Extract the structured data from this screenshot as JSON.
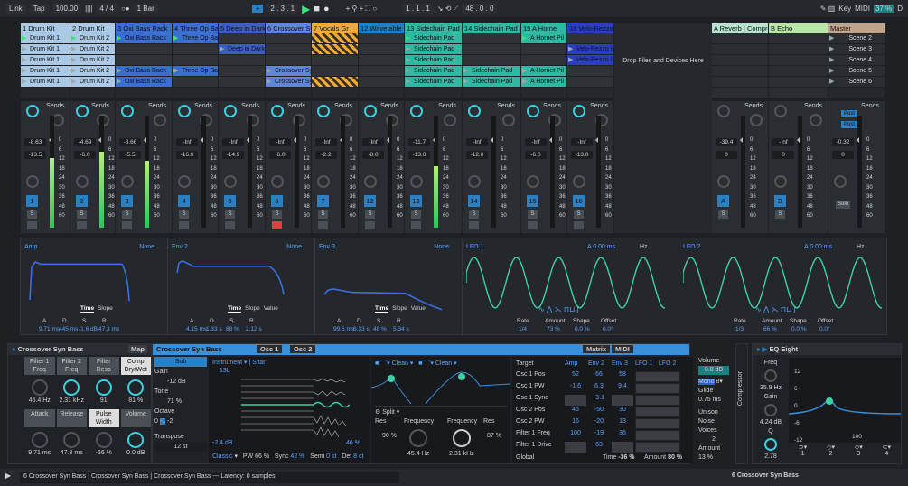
{
  "transport": {
    "link": "Link",
    "tap": "Tap",
    "tempo": "100.00",
    "signature": "4 / 4",
    "quantize": "1 Bar",
    "position": "2 .  3 .  1",
    "loop_start": "1 .  1 .  1",
    "loop_length": "48 .  0 .  0",
    "key": "Key",
    "midi": "MIDI",
    "cpu": "37 %",
    "d": "D"
  },
  "tracks": [
    {
      "name": "1 Drum Kit",
      "color": "#a9c9e6",
      "num": "1",
      "clips": [
        [
          "Drum Kit 1",
          "play"
        ],
        [
          "Drum Kit 1",
          "trig"
        ],
        [
          "Drum Kit 1",
          "trig"
        ],
        [
          "Drum Kit 1",
          "trig"
        ],
        [
          "Drum Kit 1",
          "trig"
        ]
      ],
      "vol": "-8.63",
      "val2": "-13.5",
      "meter": 0.62
    },
    {
      "name": "2 Drum Kit",
      "color": "#a9c9e6",
      "num": "2",
      "clips": [
        [
          "Drum Kit 2",
          "play"
        ],
        [
          "Drum Kit 2",
          "trig"
        ],
        [
          "Drum Kit 2",
          "trig"
        ],
        [
          "Drum Kit 2",
          "trig"
        ],
        [
          "Drum Kit 2",
          "trig"
        ]
      ],
      "vol": "-4.69",
      "val2": "-6.0",
      "meter": 0.68
    },
    {
      "name": "3 Oxi Bass Rack",
      "color": "#3a6fd1",
      "num": "3",
      "clips": [
        [
          "Oxi Bass Rack",
          "play"
        ],
        null,
        null,
        [
          "Oxi Bass Rack",
          "trig"
        ],
        [
          "Oxi Bass Rack",
          "trig"
        ]
      ],
      "vol": "-8.66",
      "val2": "-5.5",
      "meter": 0.6
    },
    {
      "name": "4 Three Op Ba",
      "color": "#3a6fd1",
      "num": "4",
      "clips": [
        [
          "Three Op Ba",
          "play"
        ],
        null,
        null,
        [
          "Three Op Ba",
          "trig"
        ],
        null
      ],
      "vol": "-Inf",
      "val2": "-16.0",
      "meter": 0
    },
    {
      "name": "5 Deep in Dark",
      "color": "#3d5dbf",
      "num": "5",
      "clips": [
        null,
        [
          "Deep in Dark",
          "trig"
        ],
        null,
        null,
        null
      ],
      "vol": "-Inf",
      "val2": "-14.9",
      "meter": 0
    },
    {
      "name": "6 Crossover Sy",
      "color": "#5f86d9",
      "num": "6",
      "clips": [
        null,
        null,
        null,
        [
          "Crossover Sy",
          "trig"
        ],
        [
          "Crossover Sy",
          "trig"
        ]
      ],
      "vol": "-Inf",
      "val2": "-6.0",
      "meter": 0
    },
    {
      "name": "7 Vocals Gr",
      "color": "#f2a93b",
      "num": "7",
      "clips": [
        [
          "",
          "hatch"
        ],
        [
          "",
          "hatch"
        ],
        null,
        null,
        [
          "",
          "hatch"
        ]
      ],
      "vol": "-Inf",
      "val2": "-2.2",
      "meter": 0
    },
    {
      "name": "12 Wavetable",
      "color": "#1d7fc4",
      "num": "12",
      "clips": [
        null,
        null,
        null,
        null,
        null
      ],
      "vol": "-Inf",
      "val2": "-8.0",
      "meter": 0
    },
    {
      "name": "13 Sidechain Pad",
      "color": "#2fb8a2",
      "num": "13",
      "clips": [
        [
          "Sidechain Pad",
          "play"
        ],
        [
          "Sidechain Pad",
          "trig"
        ],
        [
          "Sidechain Pad",
          "trig"
        ],
        [
          "Sidechain Pad",
          "trig"
        ],
        [
          "Sidechain Pad",
          "trig"
        ]
      ],
      "vol": "-11.7",
      "val2": "-13.0",
      "meter": 0.55
    },
    {
      "name": "14 Sidechain Pad",
      "color": "#2fb8a2",
      "num": "14",
      "clips": [
        null,
        null,
        null,
        [
          "Sidechain Pad",
          "trig"
        ],
        [
          "Sidechain Pad",
          "trig"
        ]
      ],
      "vol": "-Inf",
      "val2": "-12.0",
      "meter": 0
    },
    {
      "name": "15 A Horne",
      "color": "#2fb8a2",
      "num": "15",
      "clips": [
        [
          "A Hornet Pil",
          "play"
        ],
        null,
        null,
        [
          "A Hornet Pil",
          "trig"
        ],
        [
          "A Hornet Pil",
          "trig"
        ]
      ],
      "vol": "-Inf",
      "val2": "-6.0",
      "meter": 0
    },
    {
      "name": "16 Velo-Rezzo",
      "color": "#2a3fbf",
      "num": "16",
      "clips": [
        null,
        [
          "Velo-Rezzo I",
          "trig"
        ],
        [
          "Velo-Rezzo I",
          "trig"
        ],
        null,
        null
      ],
      "vol": "-Inf",
      "val2": "-13.0",
      "meter": 0
    }
  ],
  "drop_text": "Drop Files and Devices Here",
  "returns": [
    {
      "name": "A Reverb | Compre",
      "color": "#b5e3cf",
      "num": "A",
      "vol": "-39.4",
      "val2": "0"
    },
    {
      "name": "B Echo",
      "color": "#b8e6a8",
      "num": "B",
      "vol": "-Inf",
      "val2": "0"
    }
  ],
  "master": {
    "name": "Master",
    "color": "#c0a48b",
    "vol": "-0.32",
    "val2": "0",
    "scenes": [
      "Scene 2",
      "Scene 3",
      "Scene 4",
      "Scene 5",
      "Scene 6"
    ],
    "post": "Post",
    "solo": "Solo"
  },
  "sends_label": "Sends",
  "solo_label": "S",
  "scale": [
    "0",
    "6",
    "12",
    "18",
    "24",
    "30",
    "36",
    "48",
    "60"
  ],
  "envelopes": [
    {
      "title": "Amp",
      "mode": "None",
      "tabs": [
        "Time",
        "Slope"
      ],
      "params": [
        [
          "A",
          "9.71 ms"
        ],
        [
          "D",
          "445 ms"
        ],
        [
          "S",
          "-1.6 dB"
        ],
        [
          "R",
          "47.3 ms"
        ]
      ]
    },
    {
      "title": "Env 2",
      "mode": "None",
      "tabs": [
        "Time",
        "Slope",
        "Value"
      ],
      "params": [
        [
          "A",
          "4.15 ms"
        ],
        [
          "D",
          "1.33 s"
        ],
        [
          "S",
          "88 %"
        ],
        [
          "R",
          "2.12 s"
        ]
      ]
    },
    {
      "title": "Env 3",
      "mode": "None",
      "tabs": [
        "Time",
        "Slope",
        "Value"
      ],
      "params": [
        [
          "A",
          "99.6 ms"
        ],
        [
          "D",
          "6.33 s"
        ],
        [
          "S",
          "48 %"
        ],
        [
          "R",
          "5.34 s"
        ]
      ]
    }
  ],
  "lfos": [
    {
      "title": "LFO 1",
      "attack": "A 0.00 ms",
      "unit": "Hz",
      "params": [
        [
          "Rate",
          "1/4"
        ],
        [
          "Amount",
          "73 %"
        ],
        [
          "Shape",
          "0.0 %"
        ],
        [
          "Offset",
          "0.0°"
        ]
      ]
    },
    {
      "title": "LFO 2",
      "attack": "A 0.00 ms",
      "unit": "Hz",
      "params": [
        [
          "Rate",
          "1/3"
        ],
        [
          "Amount",
          "66 %"
        ],
        [
          "Shape",
          "0.0 %"
        ],
        [
          "Offset",
          "0.0°"
        ]
      ]
    }
  ],
  "rack": {
    "title": "Crossover Syn Bass",
    "map": "Map",
    "macros": [
      [
        "Filter 1 Freq",
        "45.4 Hz"
      ],
      [
        "Filter 2 Freq",
        "2.31 kHz"
      ],
      [
        "Filter Reso",
        "91"
      ],
      [
        "Comp Dry/Wet",
        "81 %"
      ],
      [
        "Attack",
        "9.71 ms"
      ],
      [
        "Release",
        "47.3 ms"
      ],
      [
        "Pulse Width",
        "-66 %"
      ],
      [
        "Volume",
        "0.0 dB"
      ]
    ]
  },
  "synth": {
    "title": "Crossover Syn Bass",
    "osc1": "Osc 1",
    "osc2": "Osc 2",
    "sub": "Sub",
    "gain": "Gain",
    "gain_val": "-12 dB",
    "tone": "Tone",
    "tone_val": "71 %",
    "octave": "Octave",
    "oct": [
      "0",
      "-1",
      "-2"
    ],
    "transpose": "Transpose",
    "transpose_val": "12 st",
    "instrument": "Instrument",
    "sitar": "Sitar",
    "level": "13L",
    "osc_db": "-2.4 dB",
    "osc_pct": "46 %",
    "classic": "Classic",
    "pw": "PW",
    "pw_val": "66 %",
    "sync": "Sync",
    "sync_val": "42 %",
    "semi": "Semi",
    "semi_val": "0 st",
    "det": "Det",
    "det_val": "8 ct",
    "filter": {
      "clean": "Clean",
      "split": "Split",
      "res": "Res",
      "res1": "90 %",
      "freq": "Frequency",
      "freq1": "45.4 Hz",
      "freq2": "2.31 kHz",
      "res2": "87 %"
    },
    "matrix_tab": "Matrix",
    "midi_tab": "MIDI",
    "cols": [
      "Target",
      "Amp",
      "Env 2",
      "Env 3",
      "LFO 1",
      "LFO 2"
    ],
    "rows": [
      [
        "Osc 1 Pos",
        "52",
        "66",
        "58"
      ],
      [
        "Osc 1 PW",
        "-1.6",
        "6.3",
        "9.4"
      ],
      [
        "Osc 1 Sync",
        "",
        "-3.1",
        ""
      ],
      [
        "Osc 2 Pos",
        "45",
        "-50",
        "30"
      ],
      [
        "Osc 2 PW",
        "16",
        "-20",
        "13"
      ],
      [
        "Filter 1 Freq",
        "100",
        "-19",
        "36"
      ],
      [
        "Filter 1 Drive",
        "",
        "63",
        ""
      ]
    ],
    "global": "Global",
    "time": "Time",
    "time_val": "-36 %",
    "amount": "Amount",
    "amount_val": "80 %",
    "volume": "Volume",
    "volume_val": "0.0 dB",
    "mono": "Mono",
    "voices_n": "8",
    "glide": "Glide",
    "glide_val": "0.75 ms",
    "unison": "Unison",
    "unison_val": "Noise",
    "voices": "Voices",
    "voices_val": "2",
    "amount2": "Amount",
    "amount2_val": "13 %"
  },
  "compressor": "Compressor",
  "eq": {
    "title": "EQ Eight",
    "freq": "Freq",
    "freq_val": "35.8 Hz",
    "gain": "Gain",
    "gain_val": "4.24 dB",
    "q": "Q",
    "q_val": "2.78",
    "db": [
      "12",
      "6",
      "0",
      "-6",
      "-12"
    ],
    "hz": "100",
    "bands": [
      "1",
      "2",
      "3",
      "4"
    ]
  },
  "status": {
    "text": "6 Crossover Syn Bass | Crossover Syn Bass | Crossover Syn Bass --- Latency: 0 samples",
    "track": "6 Crossover Syn Bass"
  },
  "colors": {
    "accent": "#5aa3ff",
    "teal": "#3fd0a8"
  }
}
